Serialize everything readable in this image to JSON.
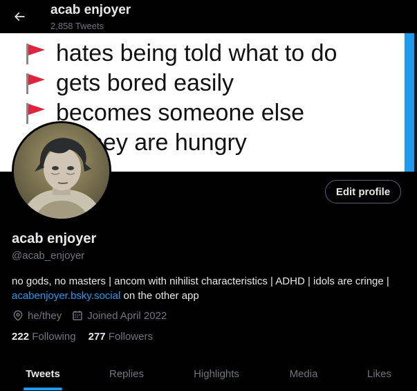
{
  "header": {
    "display_name": "acab enjoyer",
    "tweet_count": "2,858 Tweets"
  },
  "banner": {
    "lines": [
      "",
      "hates being told what to do",
      "gets bored easily",
      "becomes someone else",
      "hey are hungry"
    ],
    "flag_color": "#e0243d"
  },
  "actions": {
    "edit_profile": "Edit profile"
  },
  "profile": {
    "name": "acab enjoyer",
    "handle": "@acab_enjoyer",
    "bio_text": "no gods, no masters | ancom with nihilist characteristics | ADHD | idols are cringe |",
    "bio_link": "acabenjoyer.bsky.social",
    "bio_suffix": " on the other app",
    "pronouns": "he/they",
    "joined": "Joined April 2022",
    "following_count": "222",
    "following_label": "Following",
    "followers_count": "277",
    "followers_label": "Followers"
  },
  "tabs": [
    {
      "label": "Tweets",
      "active": true
    },
    {
      "label": "Replies",
      "active": false
    },
    {
      "label": "Highlights",
      "active": false
    },
    {
      "label": "Media",
      "active": false
    },
    {
      "label": "Likes",
      "active": false
    }
  ],
  "colors": {
    "accent": "#1d9bf0",
    "muted": "#71767b",
    "text": "#e7e9ea",
    "background": "#000000"
  }
}
